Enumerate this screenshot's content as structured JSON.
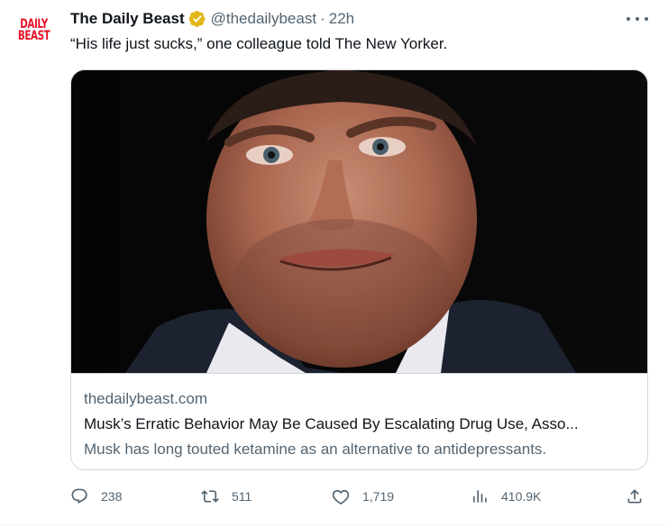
{
  "tweet": {
    "avatar_logo": "DAILY BEAST",
    "display_name": "The Daily Beast",
    "handle": "@thedailybeast",
    "separator": "·",
    "time": "22h",
    "text": "“His life just sucks,” one colleague told The New Yorker."
  },
  "card": {
    "image_icon": "photo-elon-musk",
    "domain": "thedailybeast.com",
    "title": "Musk’s Erratic Behavior May Be Caused By Escalating Drug Use, Asso...",
    "description": "Musk has long touted ketamine as an alternative to antidepressants."
  },
  "actions": {
    "reply_count": "238",
    "retweet_count": "511",
    "like_count": "1,719",
    "views_count": "410.9K"
  },
  "colors": {
    "verified_gold": "#e2b719",
    "brand_red": "#e8132a",
    "secondary_text": "#536471"
  }
}
